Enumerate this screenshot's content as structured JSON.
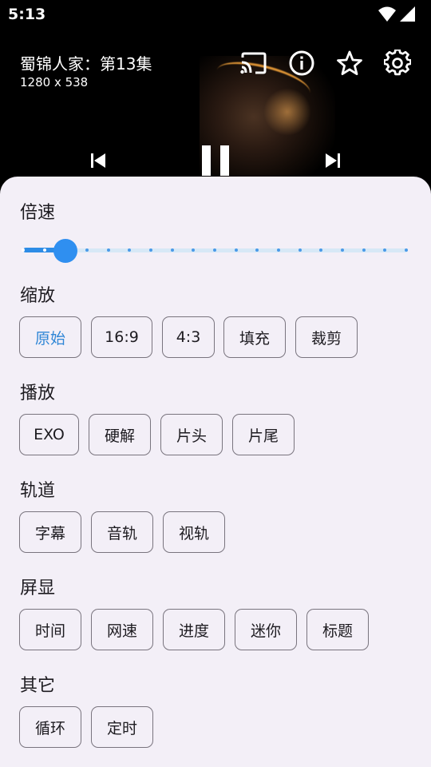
{
  "status": {
    "time": "5:13"
  },
  "video": {
    "title": "蜀锦人家：第13集",
    "resolution": "1280 x 538"
  },
  "icons": {
    "cast": "cast-icon",
    "info": "info-icon",
    "favorite": "star-icon",
    "settings": "gear-icon",
    "prev": "skip-previous-icon",
    "pause": "pause-icon",
    "next": "skip-next-icon"
  },
  "colors": {
    "accent": "#2f8ff0",
    "sheet_bg": "#f3eff7",
    "chip_border": "#79747e",
    "selected_text": "#2f86d6"
  },
  "speed": {
    "title": "倍速",
    "selected_index": 2,
    "tick_count": 19
  },
  "scale": {
    "title": "缩放",
    "options": [
      "原始",
      "16:9",
      "4:3",
      "填充",
      "裁剪"
    ],
    "selected": "原始"
  },
  "playback": {
    "title": "播放",
    "options": [
      "EXO",
      "硬解",
      "片头",
      "片尾"
    ]
  },
  "tracks": {
    "title": "轨道",
    "options": [
      "字幕",
      "音轨",
      "视轨"
    ]
  },
  "display": {
    "title": "屏显",
    "options": [
      "时间",
      "网速",
      "进度",
      "迷你",
      "标题"
    ]
  },
  "other": {
    "title": "其它",
    "options": [
      "循环",
      "定时"
    ]
  }
}
